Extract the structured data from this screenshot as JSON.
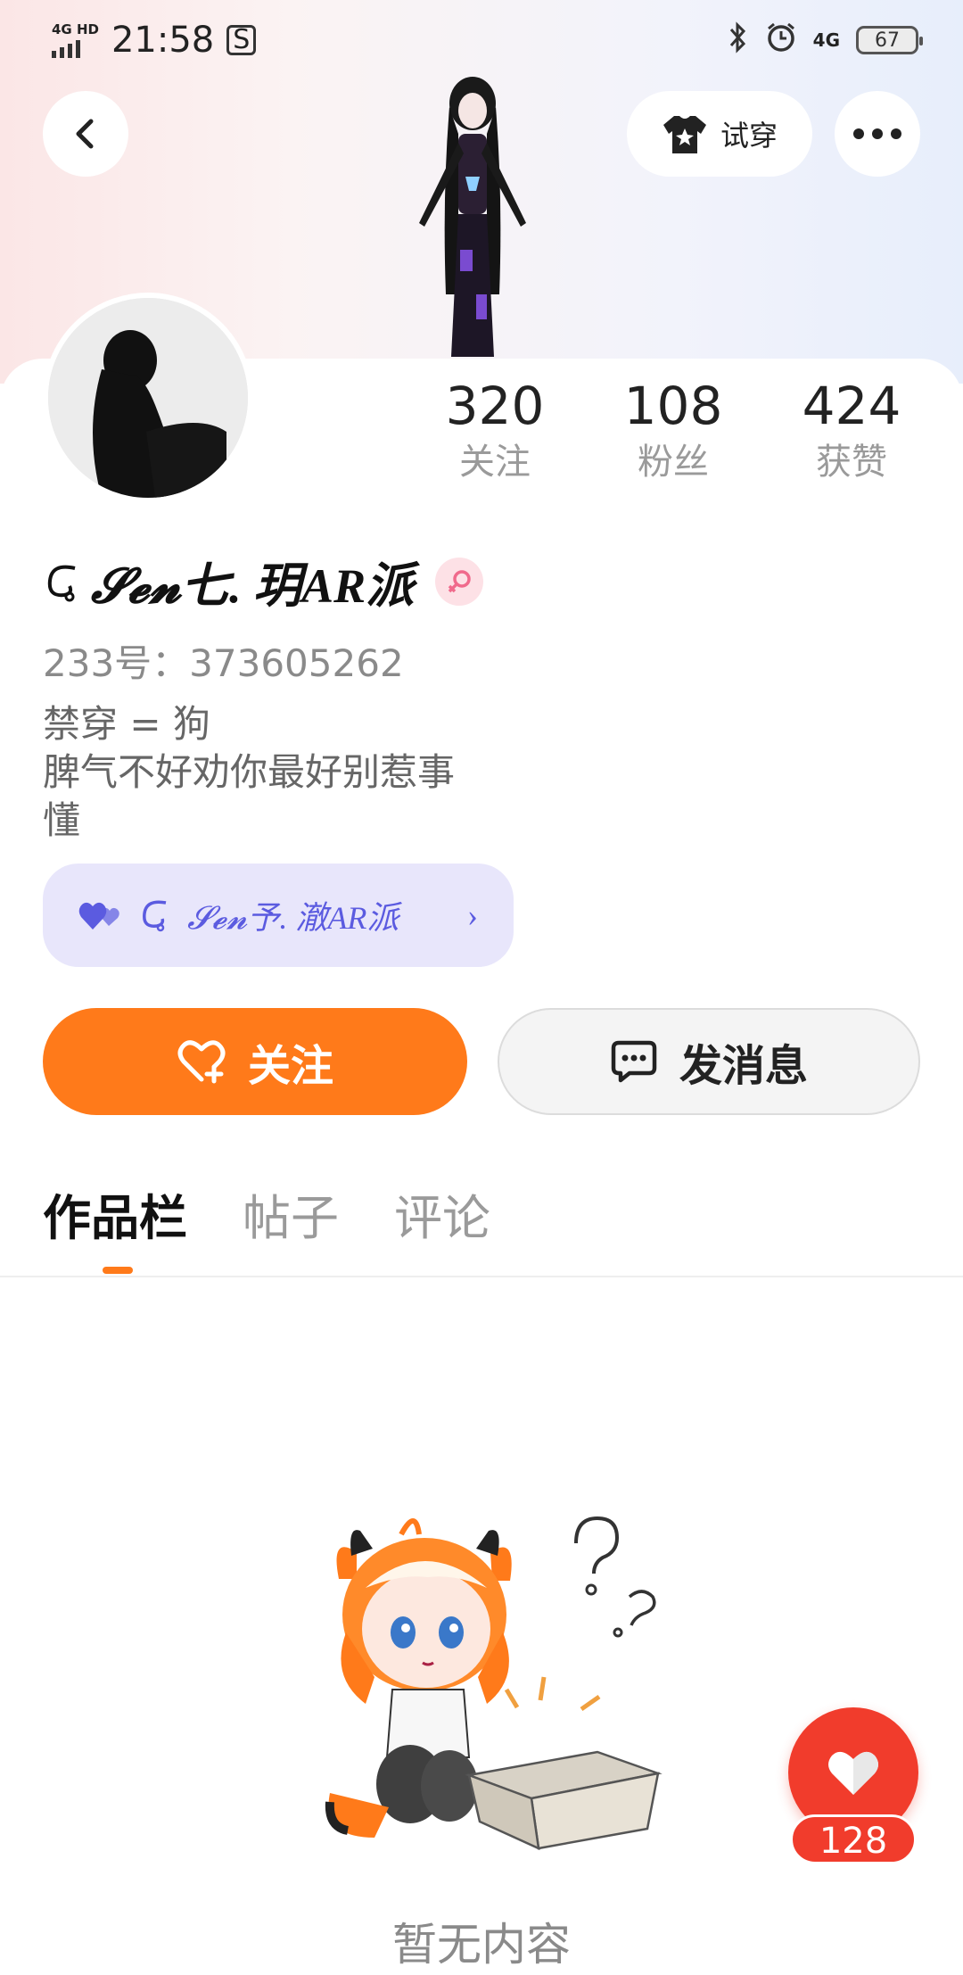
{
  "status_bar": {
    "network": "4G HD",
    "time": "21:58",
    "right_network": "4G",
    "battery": "67"
  },
  "header": {
    "try_on_label": "试穿"
  },
  "profile": {
    "stats": [
      {
        "value": "320",
        "label": "关注"
      },
      {
        "value": "108",
        "label": "粉丝"
      },
      {
        "value": "424",
        "label": "获赞"
      }
    ],
    "username": "𝓢𝓮𝓷七. 玥AR派",
    "uid": "233号：373605262",
    "bio": [
      "禁穿 = 狗",
      "脾气不好劝你最好别惹事",
      "懂"
    ],
    "partner_name": "𝓢𝓮𝓷予. 澈AR派"
  },
  "actions": {
    "follow_label": "关注",
    "message_label": "发消息"
  },
  "tabs": [
    "作品栏",
    "帖子",
    "评论"
  ],
  "empty_state": {
    "text": "暂无内容"
  },
  "like_fab": {
    "count": "128"
  },
  "colors": {
    "accent": "#ff7a1a",
    "like": "#f13c2c",
    "partner_bg": "#e8e6fb",
    "partner_text": "#5b5be0",
    "gender_badge": "#fde1e6"
  }
}
